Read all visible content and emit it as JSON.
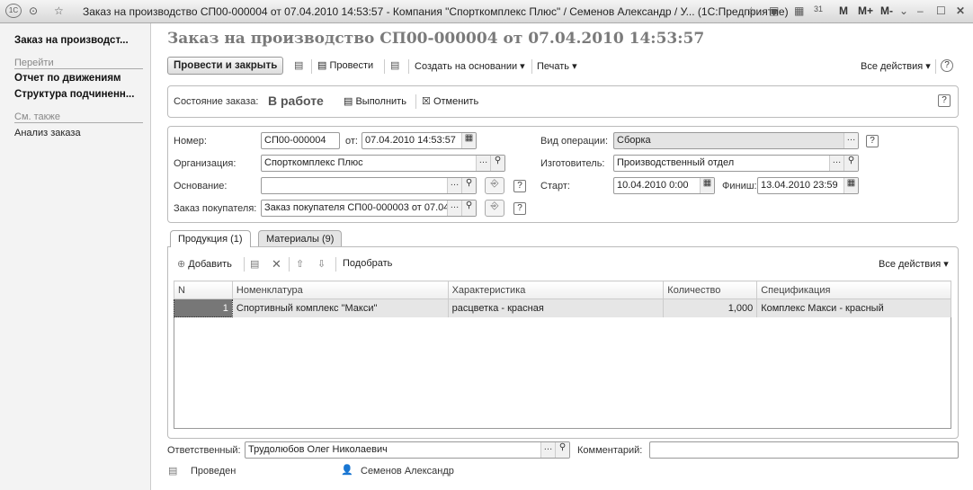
{
  "window": {
    "title": "Заказ на производство СП00-000004 от 07.04.2010 14:53:57 - Компания \"Спорткомплекс Плюс\" / Семенов Александр / У... (1С:Предприятие)",
    "logo": "1С",
    "m": "M",
    "mplus": "M+",
    "mminus": "M-"
  },
  "sidebar": {
    "current": "Заказ на производст...",
    "goto_header": "Перейти",
    "goto_items": [
      "Отчет по движениям",
      "Структура подчиненн..."
    ],
    "see_also_header": "См. также",
    "see_also_items": [
      "Анализ заказа"
    ]
  },
  "page": {
    "title": "Заказ на производство СП00-000004 от 07.04.2010 14:53:57"
  },
  "toolbar": {
    "post_close": "Провести и закрыть",
    "post": "Провести",
    "create_based": "Создать на основании",
    "print": "Печать",
    "all_actions": "Все действия",
    "help": "?"
  },
  "status": {
    "label": "Состояние заказа:",
    "value": "В работе",
    "complete": "Выполнить",
    "cancel": "Отменить",
    "help": "?"
  },
  "fields": {
    "number_label": "Номер:",
    "number": "СП00-000004",
    "date_label": "от:",
    "date": "07.04.2010 14:53:57",
    "org_label": "Организация:",
    "org": "Спорткомплекс Плюс",
    "basis_label": "Основание:",
    "basis": "",
    "customer_order_label": "Заказ покупателя:",
    "customer_order": "Заказ покупателя СП00-000003 от 07.04",
    "operation_label": "Вид операции:",
    "operation": "Сборка",
    "maker_label": "Изготовитель:",
    "maker": "Производственный отдел",
    "start_label": "Старт:",
    "start": "10.04.2010  0:00",
    "finish_label": "Финиш:",
    "finish": "13.04.2010 23:59"
  },
  "tabs": [
    {
      "label": "Продукция (1)",
      "active": true
    },
    {
      "label": "Материалы (9)",
      "active": false
    }
  ],
  "table_toolbar": {
    "add": "Добавить",
    "pick": "Подобрать",
    "all_actions": "Все действия"
  },
  "table": {
    "columns": [
      "N",
      "Номенклатура",
      "Характеристика",
      "Количество",
      "Спецификация"
    ],
    "rows": [
      [
        "1",
        "Спортивный комплекс \"Макси\"",
        "расцветка - красная",
        "1,000",
        "Комплекс Макси - красный"
      ]
    ]
  },
  "footer": {
    "responsible_label": "Ответственный:",
    "responsible": "Трудолюбов Олег Николаевич",
    "comment_label": "Комментарий:",
    "comment": "",
    "posted": "Проведен",
    "author": "Семенов Александр"
  }
}
